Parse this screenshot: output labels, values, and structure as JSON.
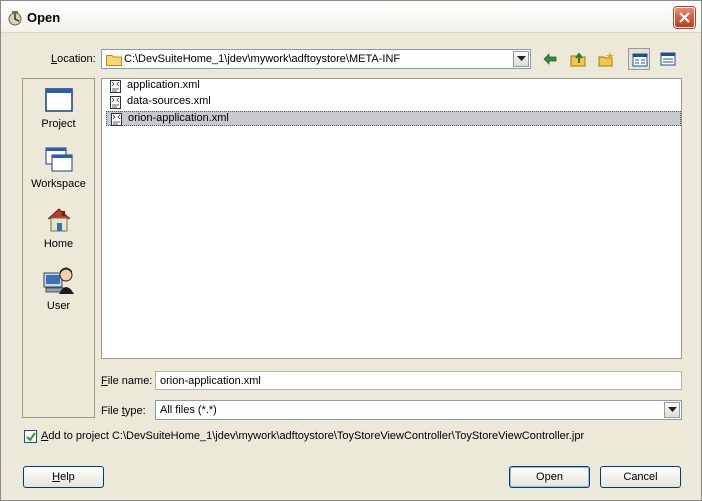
{
  "window": {
    "title": "Open"
  },
  "location": {
    "label_u": "L",
    "label_rest": "ocation:",
    "path": "C:\\DevSuiteHome_1\\jdev\\mywork\\adftoystore\\META-INF"
  },
  "toolbar": {
    "icons": [
      "back-icon",
      "up-folder-icon",
      "new-folder-icon",
      "list-view-icon",
      "details-view-icon"
    ]
  },
  "sidebar": {
    "items": [
      {
        "label": "Project",
        "icon": "project-icon"
      },
      {
        "label": "Workspace",
        "icon": "workspace-icon"
      },
      {
        "label": "Home",
        "icon": "home-icon"
      },
      {
        "label": "User",
        "icon": "user-icon"
      }
    ]
  },
  "files": [
    {
      "name": "application.xml",
      "selected": false
    },
    {
      "name": "data-sources.xml",
      "selected": false
    },
    {
      "name": "orion-application.xml",
      "selected": true
    }
  ],
  "filename": {
    "label_u": "F",
    "label_rest": "ile name:",
    "value": "orion-application.xml"
  },
  "filetype": {
    "label_pre": "File ",
    "label_u": "t",
    "label_rest": "ype:",
    "value": "All files (*.*)"
  },
  "add_to_project": {
    "checked": true,
    "label_u": "A",
    "label_rest": "dd to project C:\\DevSuiteHome_1\\jdev\\mywork\\adftoystore\\ToyStoreViewController\\ToyStoreViewController.jpr"
  },
  "buttons": {
    "help_u": "H",
    "help_rest": "elp",
    "open": "Open",
    "cancel": "Cancel"
  },
  "colors": {
    "dialog_bg": "#ece9d8",
    "selection": "#c8c8d0",
    "close_button": "#c1391b"
  }
}
